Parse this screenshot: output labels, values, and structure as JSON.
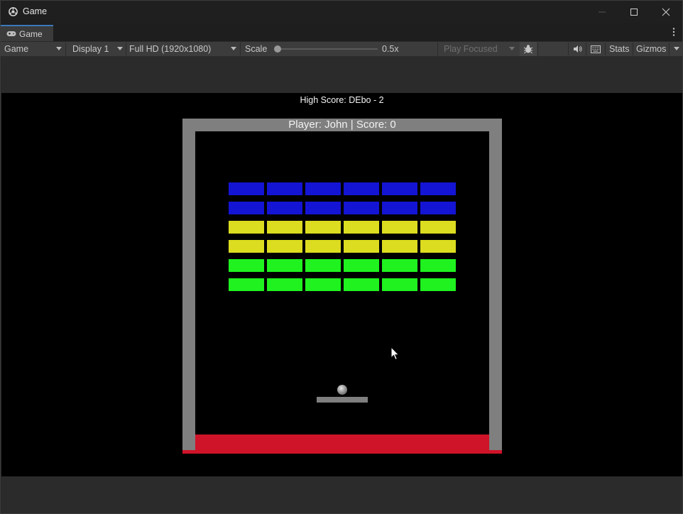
{
  "window": {
    "title": "Game"
  },
  "tab": {
    "label": "Game"
  },
  "toolbar": {
    "view_mode": "Game",
    "display": "Display 1",
    "resolution": "Full HD (1920x1080)",
    "scale_label": "Scale",
    "scale_value": "0.5x",
    "scale_fraction": 0.0,
    "play_mode": "Play Focused",
    "stats_label": "Stats",
    "gizmos_label": "Gizmos"
  },
  "game": {
    "high_score_text": "High Score: DEbo - 2",
    "player_score_text": "Player: John | Score: 0",
    "brick_rows": [
      {
        "color": "#1414d4",
        "count": 6
      },
      {
        "color": "#1414d4",
        "count": 6
      },
      {
        "color": "#dcdc20",
        "count": 6
      },
      {
        "color": "#dcdc20",
        "count": 6
      },
      {
        "color": "#1ff21f",
        "count": 6
      },
      {
        "color": "#1ff21f",
        "count": 6
      }
    ],
    "colors": {
      "wall": "#7f7f7f",
      "deadzone": "#cf1328",
      "background": "#000000"
    }
  }
}
